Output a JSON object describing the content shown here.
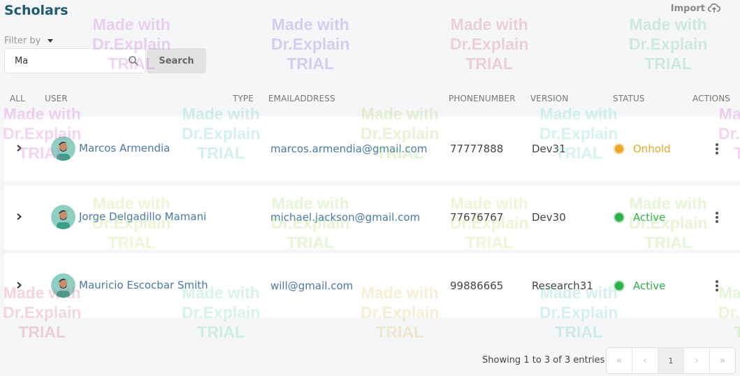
{
  "page": {
    "title": "Scholars",
    "import_label": "Import"
  },
  "filter": {
    "label": "Filter by",
    "search_value": "Ma",
    "search_button": "Search"
  },
  "table": {
    "headers": {
      "all": "ALL",
      "user": "USER",
      "type": "TYPE",
      "email": "EMAILADDRESS",
      "phone": "PHONENUMBER",
      "version": "VERSION",
      "status": "STATUS",
      "actions": "ACTIONS"
    },
    "rows": [
      {
        "name": "Marcos Armendia",
        "email": "marcos.armendia@gmail.com",
        "phone": "77777888",
        "version": "Dev31",
        "status": "Onhold",
        "status_color": "#e9a825"
      },
      {
        "name": "Jorge Delgadillo Mamani",
        "email": "michael.jackson@gmail.com",
        "phone": "77676767",
        "version": "Dev30",
        "status": "Active",
        "status_color": "#2bb04b"
      },
      {
        "name": "Mauricio Escocbar Smith",
        "email": "will@gmail.com",
        "phone": "99886665",
        "version": "Research31",
        "status": "Active",
        "status_color": "#2bb04b"
      }
    ]
  },
  "pagination": {
    "summary": "Showing 1 to 3 of 3 entries",
    "first": "«",
    "prev": "‹",
    "current": "1",
    "next": "›",
    "last": "»"
  },
  "watermark": {
    "line1": "Made with",
    "line2": "Dr.Explain",
    "line3": "TRIAL"
  }
}
